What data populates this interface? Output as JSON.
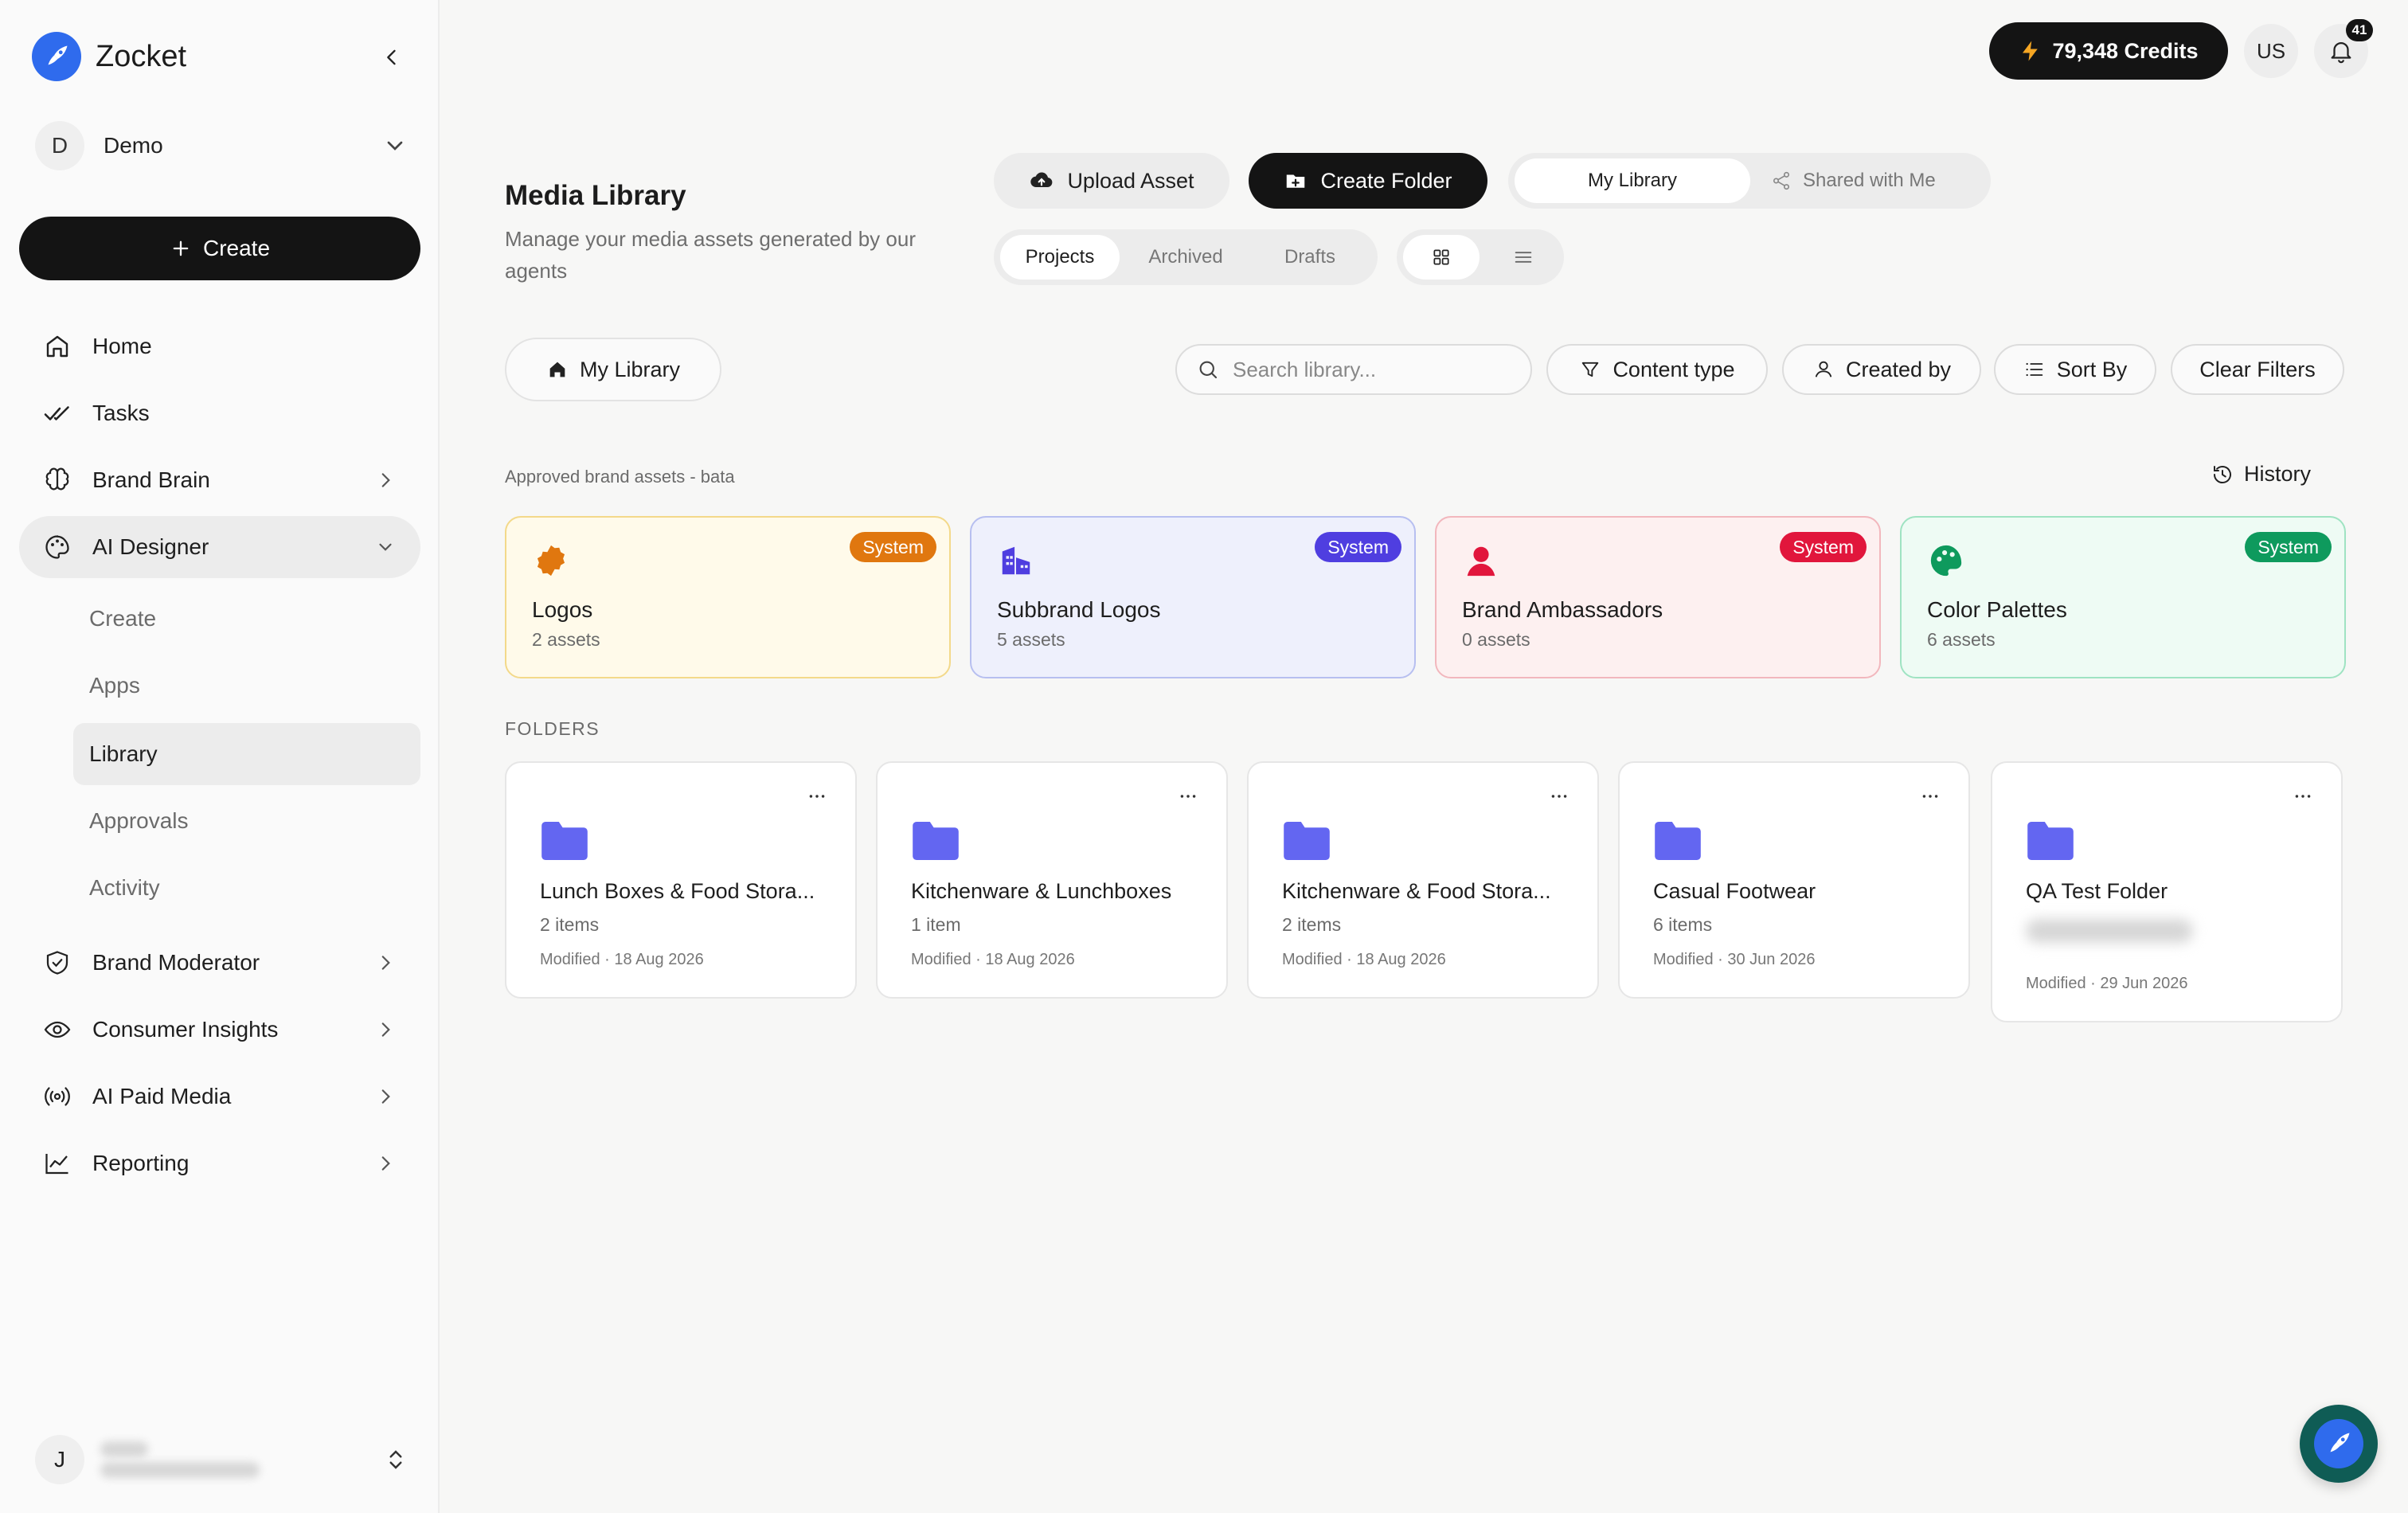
{
  "brand": {
    "name": "Zocket"
  },
  "workspace": {
    "initial": "D",
    "name": "Demo"
  },
  "sidebar": {
    "create_label": "Create",
    "items": [
      {
        "label": "Home"
      },
      {
        "label": "Tasks"
      },
      {
        "label": "Brand Brain"
      },
      {
        "label": "AI Designer"
      },
      {
        "label": "Brand Moderator"
      },
      {
        "label": "Consumer Insights"
      },
      {
        "label": "AI Paid Media"
      },
      {
        "label": "Reporting"
      }
    ],
    "sub_items": [
      {
        "label": "Create"
      },
      {
        "label": "Apps"
      },
      {
        "label": "Library"
      },
      {
        "label": "Approvals"
      },
      {
        "label": "Activity"
      }
    ]
  },
  "user": {
    "initial": "J"
  },
  "topbar": {
    "credits": "79,348 Credits",
    "lang": "US",
    "notifications": "41"
  },
  "header": {
    "title": "Media Library",
    "subtitle": "Manage your media assets generated by our agents",
    "upload_label": "Upload Asset",
    "create_folder_label": "Create Folder",
    "library_toggle": {
      "my": "My Library",
      "shared": "Shared with Me"
    },
    "tabs": [
      "Projects",
      "Archived",
      "Drafts"
    ]
  },
  "filters": {
    "my_library": "My Library",
    "search_placeholder": "Search library...",
    "content_type": "Content type",
    "created_by": "Created by",
    "sort_by": "Sort By",
    "clear": "Clear Filters"
  },
  "brand_assets": {
    "label": "Approved brand assets - bata",
    "history_label": "History",
    "cards": [
      {
        "title": "Logos",
        "count": "2 assets",
        "badge": "System",
        "accent": "#e0770f",
        "bg": "#fffaea",
        "border": "#f3d98a"
      },
      {
        "title": "Subbrand Logos",
        "count": "5 assets",
        "badge": "System",
        "accent": "#4f3ee0",
        "bg": "#eef0fc",
        "border": "#b7bff0"
      },
      {
        "title": "Brand Ambassadors",
        "count": "0 assets",
        "badge": "System",
        "accent": "#e1163c",
        "bg": "#fdf0f0",
        "border": "#f2b7bd"
      },
      {
        "title": "Color Palettes",
        "count": "6 assets",
        "badge": "System",
        "accent": "#0e9a5d",
        "bg": "#eefbf4",
        "border": "#9fe3c2"
      }
    ]
  },
  "folders": {
    "label": "FOLDERS",
    "items": [
      {
        "name": "Lunch Boxes & Food Stora...",
        "count": "2 items",
        "modified": "Modified · 18 Aug 2026"
      },
      {
        "name": "Kitchenware & Lunchboxes",
        "count": "1 item",
        "modified": "Modified · 18 Aug 2026"
      },
      {
        "name": "Kitchenware & Food Stora...",
        "count": "2 items",
        "modified": "Modified · 18 Aug 2026"
      },
      {
        "name": "Casual Footwear",
        "count": "6 items",
        "modified": "Modified · 30 Jun 2026"
      },
      {
        "name": "QA Test Folder",
        "count": "",
        "modified": "Modified · 29 Jun 2026"
      }
    ]
  },
  "colors": {
    "folder": "#6366f1",
    "dark": "#141414"
  }
}
